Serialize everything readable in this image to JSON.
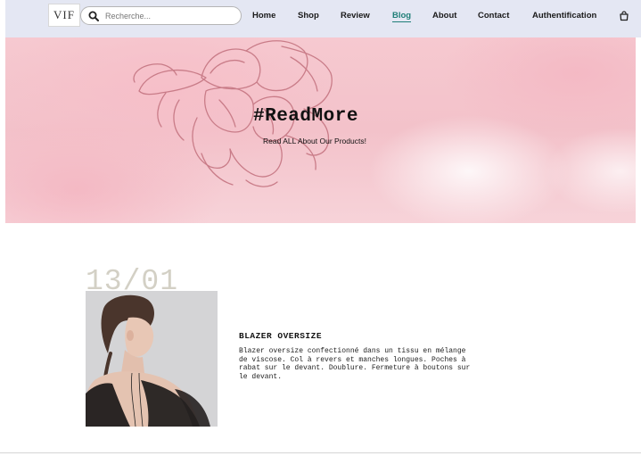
{
  "header": {
    "logo_text": "VIF",
    "search": {
      "placeholder": "Recherche...",
      "value": ""
    },
    "nav": [
      {
        "label": "Home",
        "active": false
      },
      {
        "label": "Shop",
        "active": false
      },
      {
        "label": "Review",
        "active": false
      },
      {
        "label": "Blog",
        "active": true
      },
      {
        "label": "About",
        "active": false
      },
      {
        "label": "Contact",
        "active": false
      },
      {
        "label": "Authentification",
        "active": false
      }
    ],
    "cart_icon": "shopping-bag-icon",
    "active_color": "#1f7f78"
  },
  "hero": {
    "title": "#ReadMore",
    "subtitle": "Read ALL About Our Products!",
    "background_color": "#f4c4cc",
    "flower_stroke_color": "#c97c88"
  },
  "post": {
    "date": "13/01",
    "title": "BLAZER OVERSIZE",
    "excerpt": "Blazer oversize confectionné dans un tissu en mélange de viscose. Col à revers et manches longues. Poches à rabat sur le devant. Doublure. Fermeture à boutons sur le devant."
  }
}
